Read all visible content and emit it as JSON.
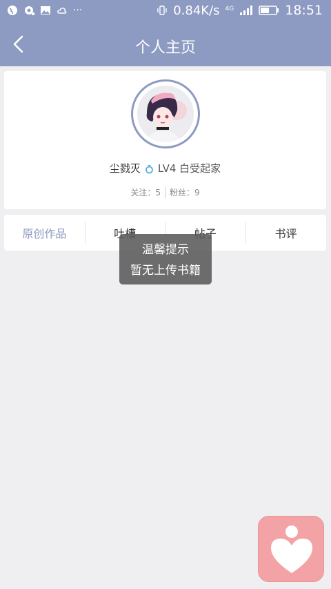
{
  "status_bar": {
    "speed": "0.84K/s",
    "network": "4G",
    "time": "18:51",
    "more": "···",
    "icons": [
      "globe-icon",
      "badge-icon",
      "image-icon",
      "cloud-icon",
      "vibrate-icon",
      "signal-icon",
      "battery-icon"
    ]
  },
  "header": {
    "title": "个人主页",
    "back_icon": "chevron-left-icon",
    "color": "#8d9ac2"
  },
  "profile": {
    "username": "尘戮灭",
    "level": "LV4 白受起家",
    "ring_icon": "ring-icon",
    "following_label": "关注：5",
    "followers_label": "粉丝：9"
  },
  "tabs": [
    {
      "label": "原创作品",
      "active": true
    },
    {
      "label": "吐槽",
      "active": false
    },
    {
      "label": "帖子",
      "active": false
    },
    {
      "label": "书评",
      "active": false
    }
  ],
  "toast": {
    "title": "温馨提示",
    "message": "暂无上传书籍"
  },
  "fab": {
    "icon": "heart-person-icon",
    "color": "#f3a3a5"
  }
}
